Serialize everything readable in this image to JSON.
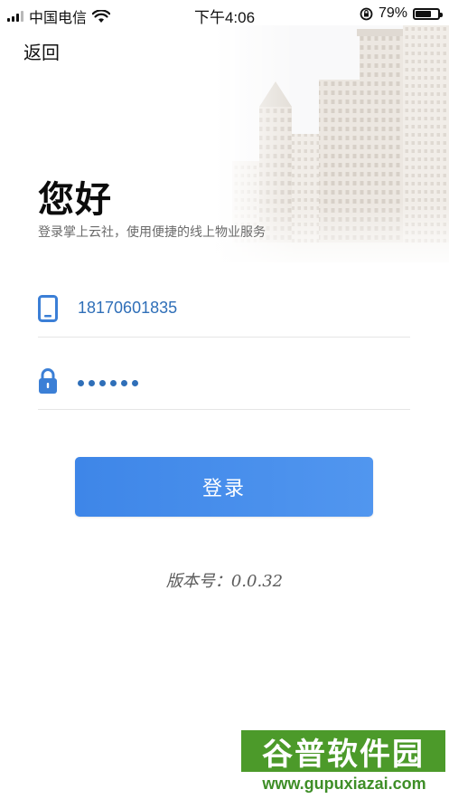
{
  "status_bar": {
    "carrier": "中国电信",
    "time": "下午4:06",
    "battery_percent": "79%",
    "battery_level": 0.79,
    "icons": [
      "signal-icon",
      "wifi-icon",
      "rotation-lock-icon",
      "battery-icon"
    ]
  },
  "nav": {
    "back_label": "返回"
  },
  "header": {
    "greeting": "您好",
    "subtitle": "登录掌上云社，使用便捷的线上物业服务"
  },
  "form": {
    "phone_icon": "phone-icon",
    "phone_value": "18170601835",
    "password_icon": "lock-icon",
    "password_dots": 6,
    "login_label": "登录"
  },
  "footer": {
    "version": "版本号：0.0.32"
  },
  "watermark": {
    "title": "谷普软件园",
    "url": "www.gupuxiazai.com"
  },
  "colors": {
    "accent": "#3e86e8",
    "input_text": "#2f6fb8",
    "watermark": "#4c9a2a"
  }
}
